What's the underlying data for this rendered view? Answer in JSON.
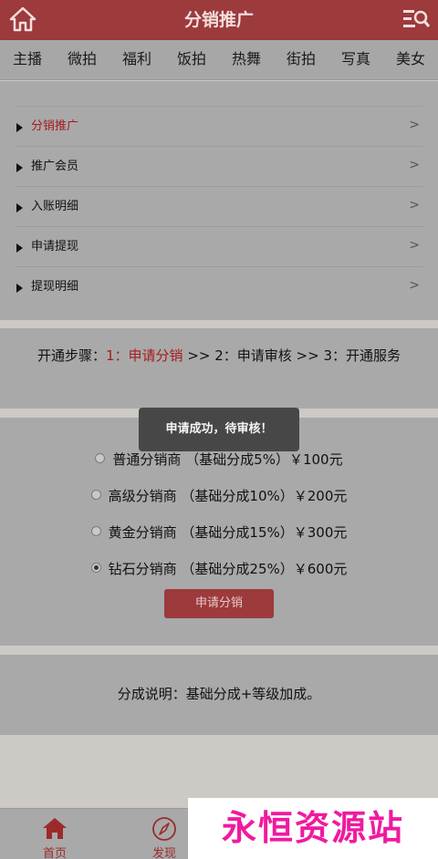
{
  "header": {
    "title": "分销推广"
  },
  "nav": {
    "categories": [
      "主播",
      "微拍",
      "福利",
      "饭拍",
      "热舞",
      "街拍",
      "写真",
      "美女"
    ]
  },
  "menu": {
    "items": [
      {
        "label": "分销推广",
        "active": true
      },
      {
        "label": "推广会员"
      },
      {
        "label": "入账明细"
      },
      {
        "label": "申请提现"
      },
      {
        "label": "提现明细"
      }
    ],
    "chevron": ">"
  },
  "steps": {
    "prefix": "开通步骤：",
    "step1": "1：申请分销",
    "sep1": " >> ",
    "step2": "2：申请审核",
    "sep2": " >> ",
    "step3": "3：开通服务"
  },
  "toast": {
    "text": "申请成功，待审核！"
  },
  "options": [
    {
      "label": "普通分销商 （基础分成5%）￥100元",
      "checked": false
    },
    {
      "label": "高级分销商 （基础分成10%）￥200元",
      "checked": false
    },
    {
      "label": "黄金分销商 （基础分成15%）￥300元",
      "checked": false
    },
    {
      "label": "钻石分销商 （基础分成25%）￥600元",
      "checked": true
    }
  ],
  "apply_button": "申请分销",
  "note": {
    "text": "分成说明：基础分成+等级加成。"
  },
  "tabbar": {
    "items": [
      {
        "label": "首页",
        "icon": "home-icon"
      },
      {
        "label": "发现",
        "icon": "compass-icon"
      }
    ]
  },
  "watermark": {
    "text": "永恒资源站"
  },
  "colors": {
    "brand": "#9c3a3c",
    "accent_red": "#a51c1c",
    "watermark": "#f01aa0"
  }
}
